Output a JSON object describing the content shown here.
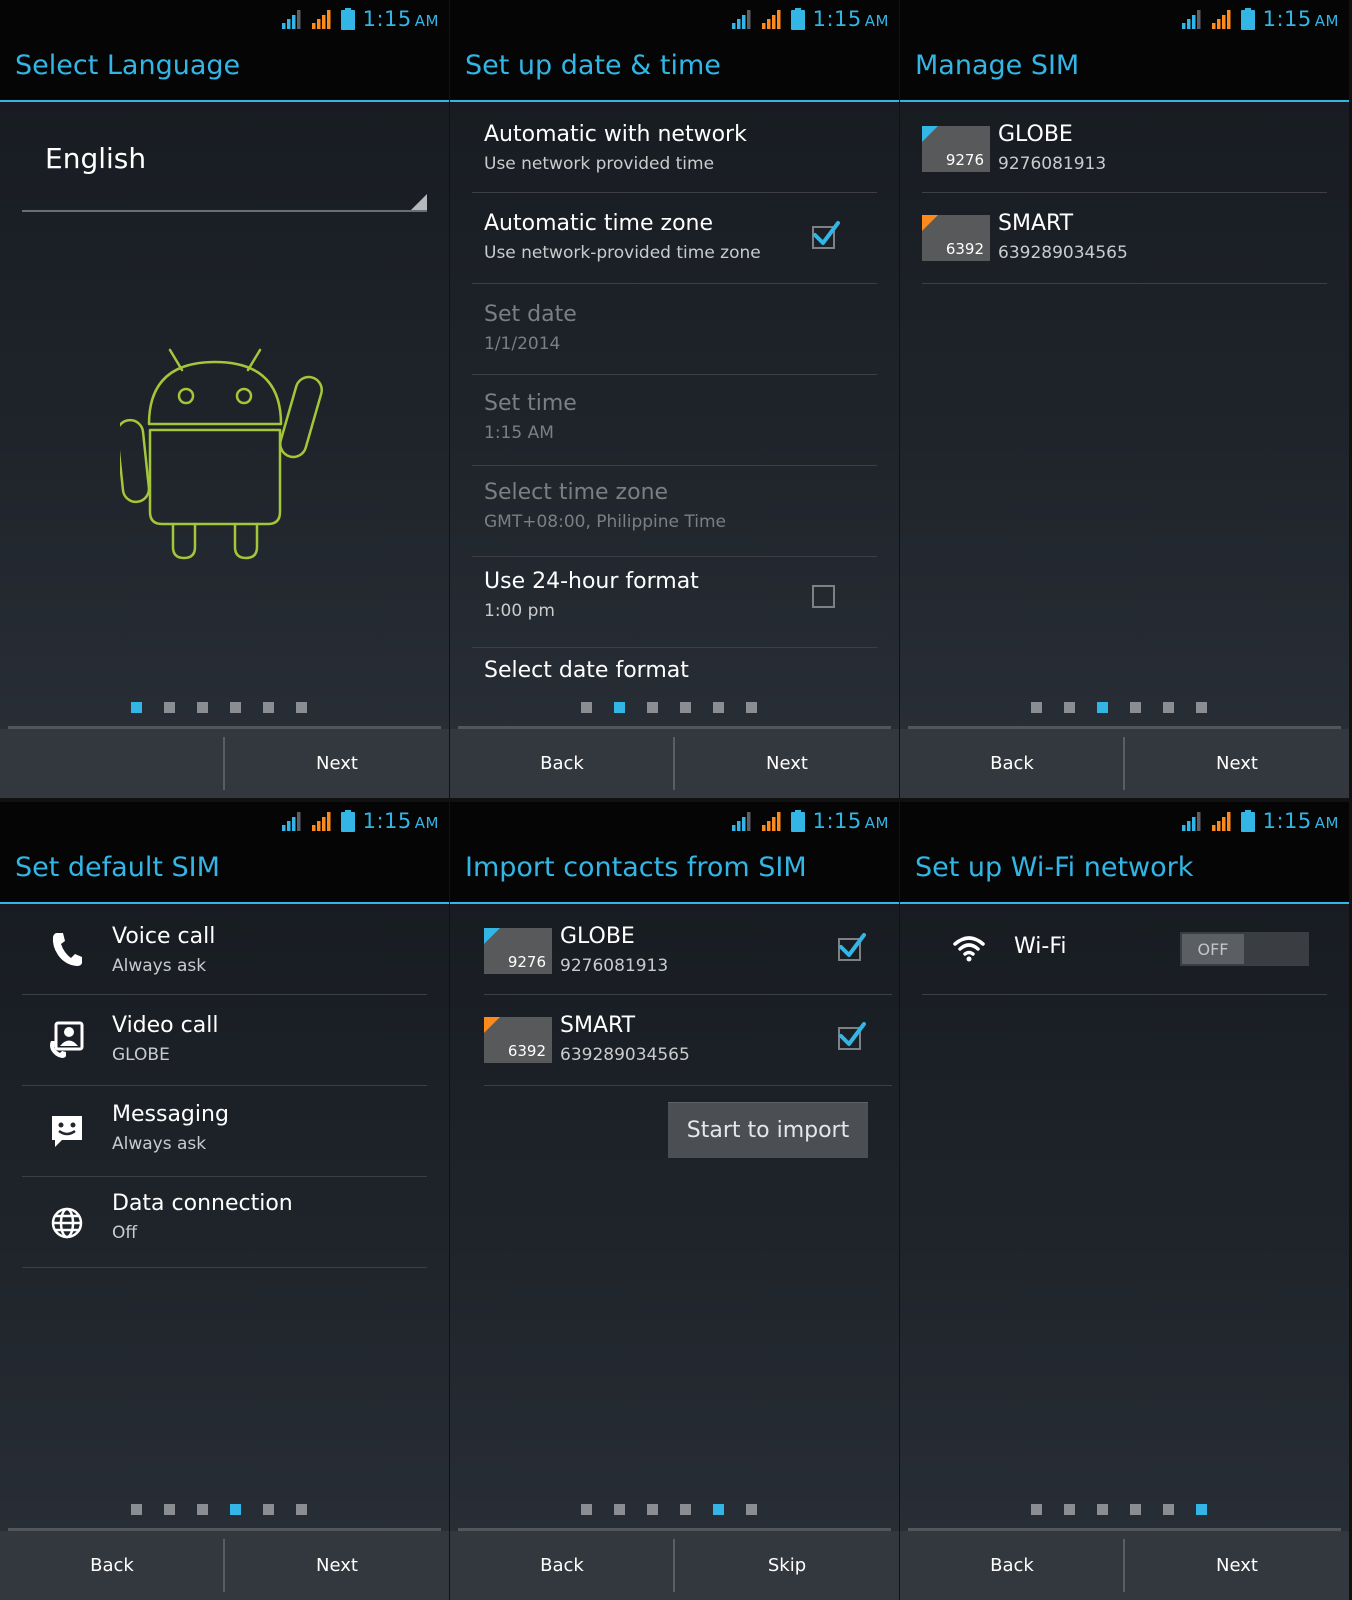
{
  "status_bar": {
    "time": "1:15",
    "ampm": "AM"
  },
  "colors": {
    "accent": "#33b5e5",
    "sim_globe": "#33b5e5",
    "sim_smart": "#ff8a1c",
    "android": "#a4c639"
  },
  "screens": {
    "language": {
      "title": "Select Language",
      "selected_language": "English",
      "page_index": 0,
      "nav": {
        "back": "",
        "next": "Next"
      }
    },
    "datetime": {
      "title": "Set up date & time",
      "items": [
        {
          "title": "Automatic with network",
          "subtitle": "Use network provided time",
          "checkbox": "none",
          "enabled": true
        },
        {
          "title": "Automatic time zone",
          "subtitle": "Use network-provided time zone",
          "checkbox": "checked",
          "enabled": true
        },
        {
          "title": "Set date",
          "subtitle": "1/1/2014",
          "checkbox": "none",
          "enabled": false
        },
        {
          "title": "Set time",
          "subtitle": "1:15 AM",
          "checkbox": "none",
          "enabled": false
        },
        {
          "title": "Select time zone",
          "subtitle": "GMT+08:00, Philippine Time",
          "checkbox": "none",
          "enabled": false
        },
        {
          "title": "Use 24-hour format",
          "subtitle": "1:00 pm",
          "checkbox": "unchecked",
          "enabled": true
        },
        {
          "title": "Select date format",
          "subtitle": "",
          "checkbox": "none",
          "enabled": true
        }
      ],
      "page_index": 1,
      "nav": {
        "back": "Back",
        "next": "Next"
      }
    },
    "manage_sim": {
      "title": "Manage SIM",
      "sims": [
        {
          "name": "GLOBE",
          "number": "9276081913",
          "badge": "9276",
          "color": "blue"
        },
        {
          "name": "SMART",
          "number": "639289034565",
          "badge": "6392",
          "color": "orange"
        }
      ],
      "page_index": 2,
      "nav": {
        "back": "Back",
        "next": "Next"
      }
    },
    "default_sim": {
      "title": "Set default SIM",
      "items": [
        {
          "icon": "phone-icon",
          "title": "Voice call",
          "subtitle": "Always ask"
        },
        {
          "icon": "video-call-icon",
          "title": "Video call",
          "subtitle": "GLOBE"
        },
        {
          "icon": "messaging-icon",
          "title": "Messaging",
          "subtitle": "Always ask"
        },
        {
          "icon": "globe-icon",
          "title": "Data connection",
          "subtitle": "Off"
        }
      ],
      "page_index": 3,
      "nav": {
        "back": "Back",
        "next": "Next"
      }
    },
    "import_contacts": {
      "title": "Import contacts from SIM",
      "sims": [
        {
          "name": "GLOBE",
          "number": "9276081913",
          "badge": "9276",
          "color": "blue",
          "checked": true
        },
        {
          "name": "SMART",
          "number": "639289034565",
          "badge": "6392",
          "color": "orange",
          "checked": true
        }
      ],
      "import_button": "Start to import",
      "page_index": 4,
      "nav": {
        "back": "Back",
        "next": "Skip"
      }
    },
    "wifi": {
      "title": "Set up Wi-Fi network",
      "wifi_label": "Wi-Fi",
      "toggle_state": "OFF",
      "page_index": 5,
      "nav": {
        "back": "Back",
        "next": "Next"
      }
    }
  }
}
